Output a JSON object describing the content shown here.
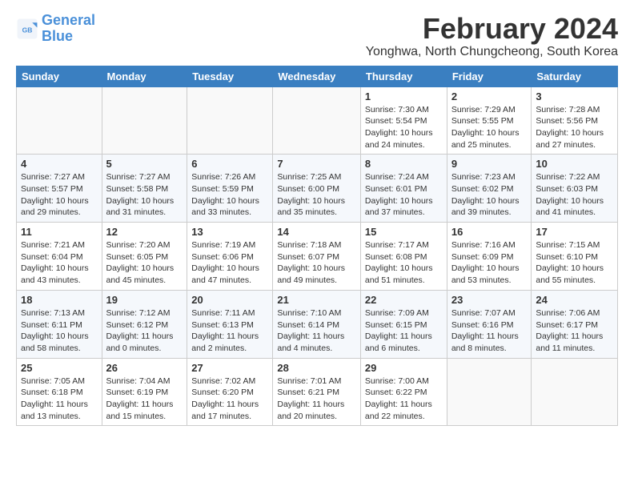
{
  "logo": {
    "line1": "General",
    "line2": "Blue"
  },
  "title": "February 2024",
  "subtitle": "Yonghwa, North Chungcheong, South Korea",
  "headers": [
    "Sunday",
    "Monday",
    "Tuesday",
    "Wednesday",
    "Thursday",
    "Friday",
    "Saturday"
  ],
  "weeks": [
    [
      {
        "num": "",
        "detail": ""
      },
      {
        "num": "",
        "detail": ""
      },
      {
        "num": "",
        "detail": ""
      },
      {
        "num": "",
        "detail": ""
      },
      {
        "num": "1",
        "detail": "Sunrise: 7:30 AM\nSunset: 5:54 PM\nDaylight: 10 hours\nand 24 minutes."
      },
      {
        "num": "2",
        "detail": "Sunrise: 7:29 AM\nSunset: 5:55 PM\nDaylight: 10 hours\nand 25 minutes."
      },
      {
        "num": "3",
        "detail": "Sunrise: 7:28 AM\nSunset: 5:56 PM\nDaylight: 10 hours\nand 27 minutes."
      }
    ],
    [
      {
        "num": "4",
        "detail": "Sunrise: 7:27 AM\nSunset: 5:57 PM\nDaylight: 10 hours\nand 29 minutes."
      },
      {
        "num": "5",
        "detail": "Sunrise: 7:27 AM\nSunset: 5:58 PM\nDaylight: 10 hours\nand 31 minutes."
      },
      {
        "num": "6",
        "detail": "Sunrise: 7:26 AM\nSunset: 5:59 PM\nDaylight: 10 hours\nand 33 minutes."
      },
      {
        "num": "7",
        "detail": "Sunrise: 7:25 AM\nSunset: 6:00 PM\nDaylight: 10 hours\nand 35 minutes."
      },
      {
        "num": "8",
        "detail": "Sunrise: 7:24 AM\nSunset: 6:01 PM\nDaylight: 10 hours\nand 37 minutes."
      },
      {
        "num": "9",
        "detail": "Sunrise: 7:23 AM\nSunset: 6:02 PM\nDaylight: 10 hours\nand 39 minutes."
      },
      {
        "num": "10",
        "detail": "Sunrise: 7:22 AM\nSunset: 6:03 PM\nDaylight: 10 hours\nand 41 minutes."
      }
    ],
    [
      {
        "num": "11",
        "detail": "Sunrise: 7:21 AM\nSunset: 6:04 PM\nDaylight: 10 hours\nand 43 minutes."
      },
      {
        "num": "12",
        "detail": "Sunrise: 7:20 AM\nSunset: 6:05 PM\nDaylight: 10 hours\nand 45 minutes."
      },
      {
        "num": "13",
        "detail": "Sunrise: 7:19 AM\nSunset: 6:06 PM\nDaylight: 10 hours\nand 47 minutes."
      },
      {
        "num": "14",
        "detail": "Sunrise: 7:18 AM\nSunset: 6:07 PM\nDaylight: 10 hours\nand 49 minutes."
      },
      {
        "num": "15",
        "detail": "Sunrise: 7:17 AM\nSunset: 6:08 PM\nDaylight: 10 hours\nand 51 minutes."
      },
      {
        "num": "16",
        "detail": "Sunrise: 7:16 AM\nSunset: 6:09 PM\nDaylight: 10 hours\nand 53 minutes."
      },
      {
        "num": "17",
        "detail": "Sunrise: 7:15 AM\nSunset: 6:10 PM\nDaylight: 10 hours\nand 55 minutes."
      }
    ],
    [
      {
        "num": "18",
        "detail": "Sunrise: 7:13 AM\nSunset: 6:11 PM\nDaylight: 10 hours\nand 58 minutes."
      },
      {
        "num": "19",
        "detail": "Sunrise: 7:12 AM\nSunset: 6:12 PM\nDaylight: 11 hours\nand 0 minutes."
      },
      {
        "num": "20",
        "detail": "Sunrise: 7:11 AM\nSunset: 6:13 PM\nDaylight: 11 hours\nand 2 minutes."
      },
      {
        "num": "21",
        "detail": "Sunrise: 7:10 AM\nSunset: 6:14 PM\nDaylight: 11 hours\nand 4 minutes."
      },
      {
        "num": "22",
        "detail": "Sunrise: 7:09 AM\nSunset: 6:15 PM\nDaylight: 11 hours\nand 6 minutes."
      },
      {
        "num": "23",
        "detail": "Sunrise: 7:07 AM\nSunset: 6:16 PM\nDaylight: 11 hours\nand 8 minutes."
      },
      {
        "num": "24",
        "detail": "Sunrise: 7:06 AM\nSunset: 6:17 PM\nDaylight: 11 hours\nand 11 minutes."
      }
    ],
    [
      {
        "num": "25",
        "detail": "Sunrise: 7:05 AM\nSunset: 6:18 PM\nDaylight: 11 hours\nand 13 minutes."
      },
      {
        "num": "26",
        "detail": "Sunrise: 7:04 AM\nSunset: 6:19 PM\nDaylight: 11 hours\nand 15 minutes."
      },
      {
        "num": "27",
        "detail": "Sunrise: 7:02 AM\nSunset: 6:20 PM\nDaylight: 11 hours\nand 17 minutes."
      },
      {
        "num": "28",
        "detail": "Sunrise: 7:01 AM\nSunset: 6:21 PM\nDaylight: 11 hours\nand 20 minutes."
      },
      {
        "num": "29",
        "detail": "Sunrise: 7:00 AM\nSunset: 6:22 PM\nDaylight: 11 hours\nand 22 minutes."
      },
      {
        "num": "",
        "detail": ""
      },
      {
        "num": "",
        "detail": ""
      }
    ]
  ]
}
